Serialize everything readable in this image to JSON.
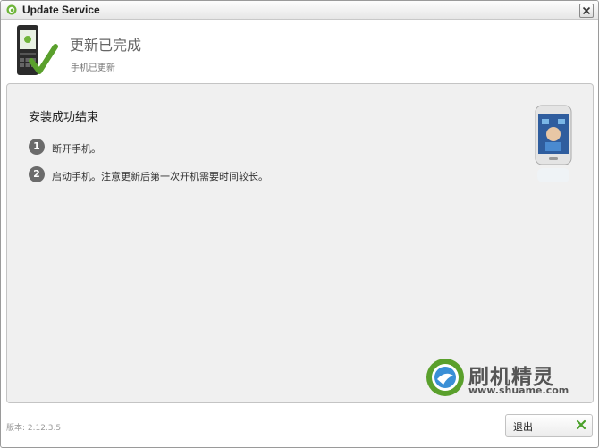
{
  "window": {
    "title": "Update Service"
  },
  "header": {
    "title": "更新已完成",
    "subtitle": "手机已更新"
  },
  "panel": {
    "title": "安装成功结束",
    "steps": [
      {
        "num": "1",
        "text": "断开手机。"
      },
      {
        "num": "2",
        "text": "启动手机。注意更新后第一次开机需要时间较长。"
      }
    ]
  },
  "watermark": {
    "name": "刷机精灵",
    "url": "www.shuame.com"
  },
  "footer": {
    "version": "版本: 2.12.3.5",
    "exit_label": "退出"
  },
  "colors": {
    "accent_green": "#5aa02c",
    "panel_bg": "#f0f0f0"
  }
}
